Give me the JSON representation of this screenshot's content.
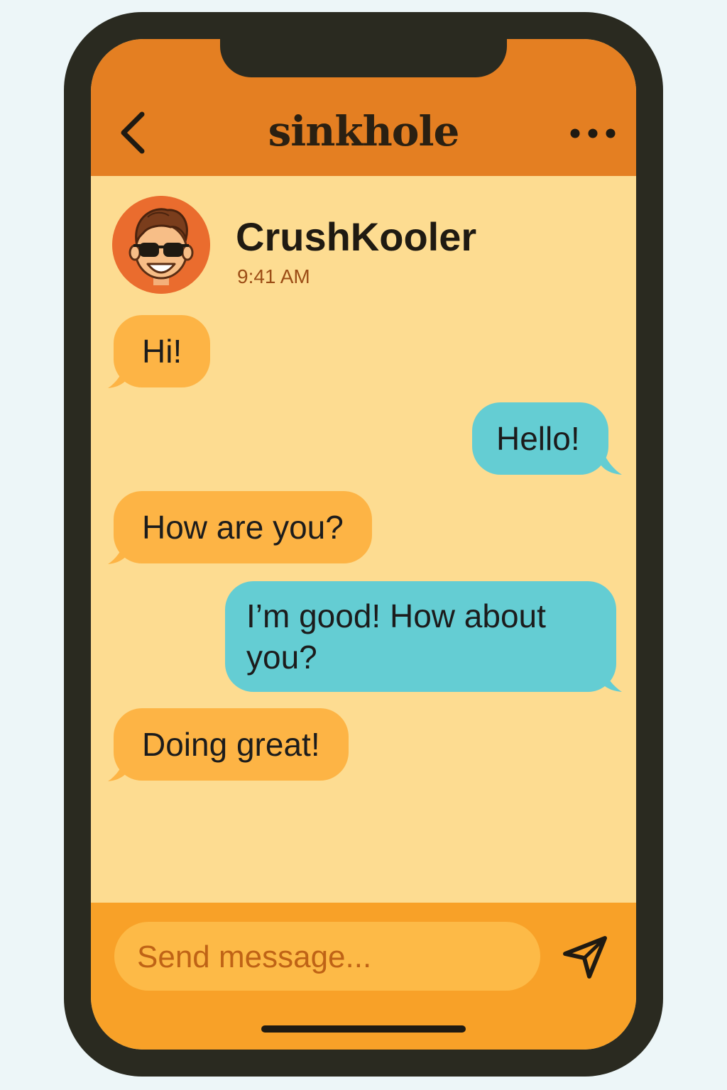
{
  "app": {
    "title": "sinkhole"
  },
  "contact": {
    "name": "CrushKooler",
    "time": "9:41 AM"
  },
  "messages": [
    {
      "text": "Hi!",
      "direction": "incoming"
    },
    {
      "text": "Hello!",
      "direction": "outgoing"
    },
    {
      "text": "How are you?",
      "direction": "incoming"
    },
    {
      "line1": "I’m good! How about",
      "line2": "you?",
      "direction": "outgoing"
    },
    {
      "text": "Doing great!",
      "direction": "incoming"
    }
  ],
  "composer": {
    "placeholder": "Send message...",
    "value": ""
  },
  "icons": {
    "back": "chevron-left-icon",
    "more": "more-horizontal-icon",
    "send": "send-icon"
  },
  "colors": {
    "header": "#e47f22",
    "background": "#fddc91",
    "incoming_bubble": "#fdb445",
    "outgoing_bubble": "#64cdd3",
    "composer": "#f8a128",
    "accent_text": "#9c4d16"
  }
}
